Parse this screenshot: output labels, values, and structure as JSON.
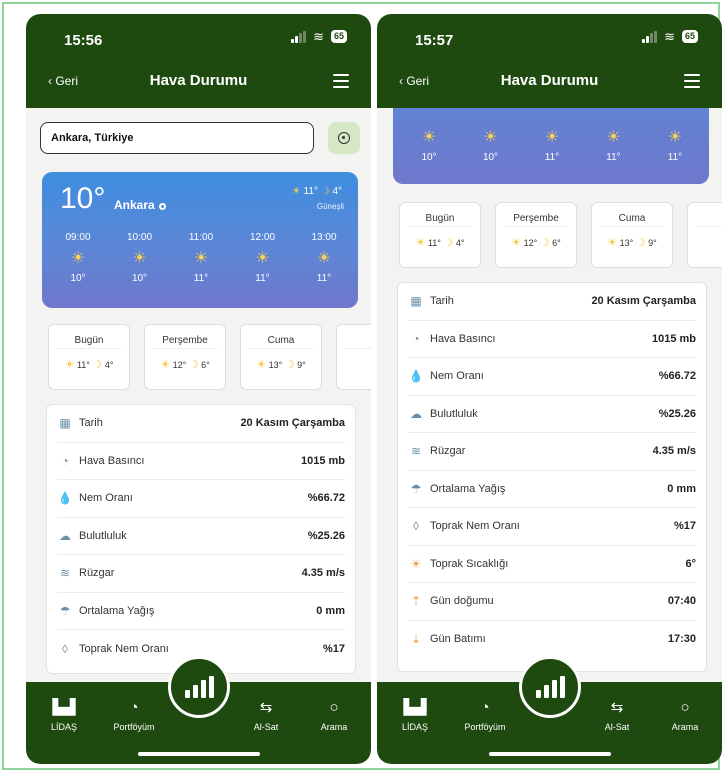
{
  "screens": [
    {
      "status": {
        "time": "15:56",
        "battery": "65"
      },
      "header": {
        "back_label": "Geri",
        "title": "Hava Durumu"
      },
      "search": {
        "value": "Ankara, Türkiye"
      },
      "current": {
        "temp": "10°",
        "city": "Ankara",
        "high": "11°",
        "low": "4°",
        "condition": "Güneşli"
      },
      "hourly": [
        {
          "time": "09:00",
          "temp": "10°"
        },
        {
          "time": "10:00",
          "temp": "10°"
        },
        {
          "time": "11:00",
          "temp": "11°"
        },
        {
          "time": "12:00",
          "temp": "11°"
        },
        {
          "time": "13:00",
          "temp": "11°"
        }
      ],
      "daily": [
        {
          "day": "Bugün",
          "high": "11°",
          "low": "4°"
        },
        {
          "day": "Perşembe",
          "high": "12°",
          "low": "6°"
        },
        {
          "day": "Cuma",
          "high": "13°",
          "low": "9°"
        }
      ],
      "details": [
        {
          "icon": "calendar-icon",
          "label": "Tarih",
          "value": "20 Kasım Çarşamba"
        },
        {
          "icon": "pressure-gauge-icon",
          "label": "Hava Basıncı",
          "value": "1015 mb"
        },
        {
          "icon": "droplet-icon",
          "label": "Nem Oranı",
          "value": "%66.72"
        },
        {
          "icon": "cloud-icon",
          "label": "Bulutluluk",
          "value": "%25.26"
        },
        {
          "icon": "wind-icon",
          "label": "Rüzgar",
          "value": "4.35 m/s"
        },
        {
          "icon": "rain-cloud-icon",
          "label": "Ortalama Yağış",
          "value": "0 mm"
        },
        {
          "icon": "soil-moisture-icon",
          "label": "Toprak Nem Oranı",
          "value": "%17"
        }
      ],
      "nav": [
        "LİDAŞ",
        "Portföyüm",
        "Al-Sat",
        "Arama"
      ]
    },
    {
      "status": {
        "time": "15:57",
        "battery": "65"
      },
      "header": {
        "back_label": "Geri",
        "title": "Hava Durumu"
      },
      "hourly": [
        {
          "time": "",
          "temp": "10°"
        },
        {
          "time": "",
          "temp": "10°"
        },
        {
          "time": "",
          "temp": "11°"
        },
        {
          "time": "",
          "temp": "11°"
        },
        {
          "time": "",
          "temp": "11°"
        }
      ],
      "daily": [
        {
          "day": "Bugün",
          "high": "11°",
          "low": "4°"
        },
        {
          "day": "Perşembe",
          "high": "12°",
          "low": "6°"
        },
        {
          "day": "Cuma",
          "high": "13°",
          "low": "9°"
        }
      ],
      "details": [
        {
          "icon": "calendar-icon",
          "label": "Tarih",
          "value": "20 Kasım Çarşamba"
        },
        {
          "icon": "pressure-gauge-icon",
          "label": "Hava Basıncı",
          "value": "1015 mb"
        },
        {
          "icon": "droplet-icon",
          "label": "Nem Oranı",
          "value": "%66.72"
        },
        {
          "icon": "cloud-icon",
          "label": "Bulutluluk",
          "value": "%25.26"
        },
        {
          "icon": "wind-icon",
          "label": "Rüzgar",
          "value": "4.35 m/s"
        },
        {
          "icon": "rain-cloud-icon",
          "label": "Ortalama Yağış",
          "value": "0 mm"
        },
        {
          "icon": "soil-moisture-icon",
          "label": "Toprak Nem Oranı",
          "value": "%17"
        },
        {
          "icon": "soil-temperature-icon",
          "label": "Toprak Sıcaklığı",
          "value": "6°"
        },
        {
          "icon": "sunrise-icon",
          "label": "Gün doğumu",
          "value": "07:40"
        },
        {
          "icon": "sunset-icon",
          "label": "Gün Batımı",
          "value": "17:30"
        }
      ],
      "nav": [
        "LİDAŞ",
        "Portföyüm",
        "Al-Sat",
        "Arama"
      ]
    }
  ],
  "colors": {
    "header": "#1f4a0f",
    "card_top": "#3f8ee0",
    "card_bottom": "#6f78cc",
    "sun": "#ffd24a",
    "location_button": "#d7e7c6"
  }
}
